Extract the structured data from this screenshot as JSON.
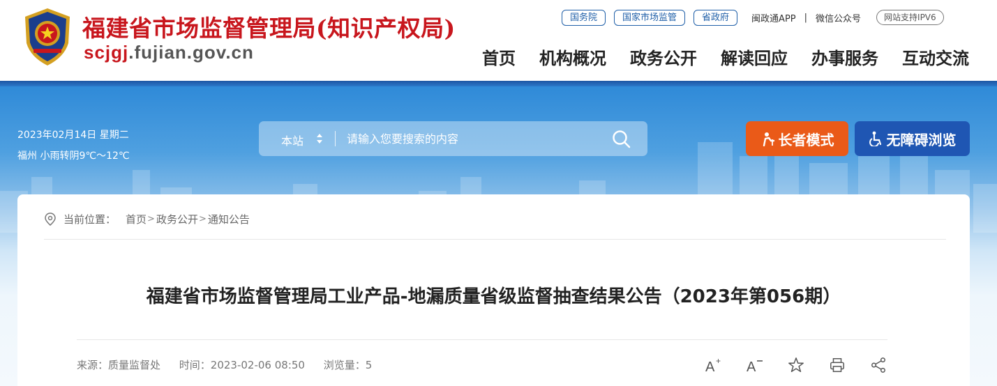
{
  "header": {
    "title": "福建省市场监督管理局(知识产权局)",
    "domain_prefix": "scjgj",
    "domain_suffix": ".fujian.gov.cn",
    "brand_color": "#c8161d",
    "toplinks": [
      "国务院",
      "国家市场监管",
      "省政府"
    ],
    "app_link": "闽政通APP",
    "separator": "|",
    "wechat_link": "微信公众号",
    "ipv6_badge": "网站支持IPV6",
    "nav": [
      "首页",
      "机构概况",
      "政务公开",
      "解读回应",
      "办事服务",
      "互动交流"
    ]
  },
  "banner": {
    "date": "2023年02月14日 星期二",
    "weather": "福州 小雨转阴9℃～12℃",
    "search": {
      "scope": "本站",
      "placeholder": "请输入您要搜索的内容"
    },
    "elder_mode": "长者模式",
    "accessible_mode": "无障碍浏览",
    "elder_color": "#ea5a18",
    "accessible_color": "#1f56b3"
  },
  "breadcrumb": {
    "label": "当前位置：",
    "items": [
      "首页",
      "政务公开",
      "通知公告"
    ],
    "separator": ">"
  },
  "article": {
    "title": "福建省市场监督管理局工业产品-地漏质量省级监督抽查结果公告（2023年第056期）",
    "source": "来源：质量监督处",
    "time": "时间：2023-02-06 08:50",
    "views": "浏览量：5"
  },
  "tools": [
    "font-increase-icon",
    "font-decrease-icon",
    "star-icon",
    "print-icon",
    "share-icon"
  ]
}
